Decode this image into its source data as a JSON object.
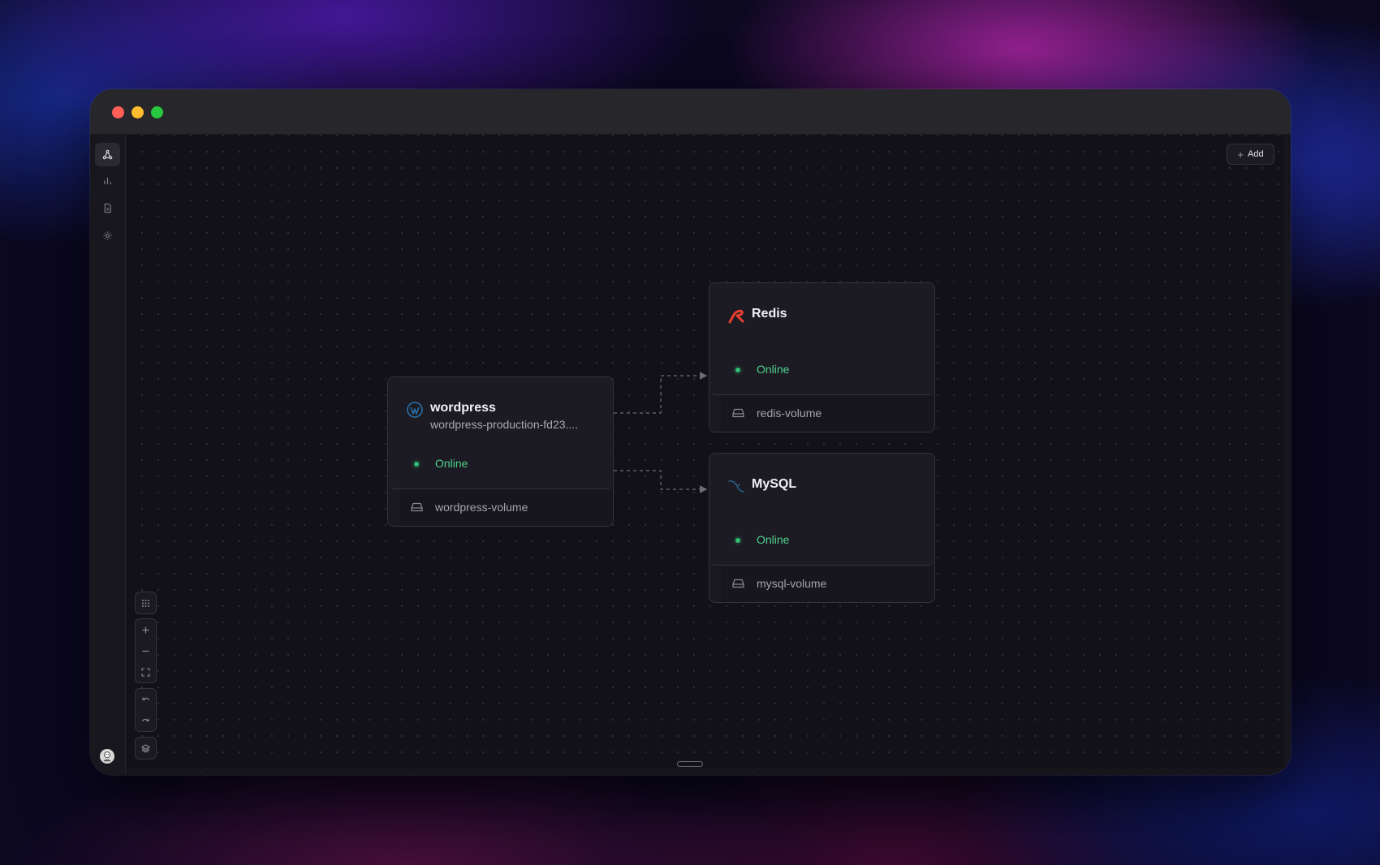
{
  "window": {
    "controls": [
      "close",
      "minimize",
      "maximize"
    ]
  },
  "sidebar": {
    "items": [
      {
        "name": "architecture",
        "icon": "network-icon",
        "active": true
      },
      {
        "name": "metrics",
        "icon": "bar-chart-icon",
        "active": false
      },
      {
        "name": "logs",
        "icon": "document-icon",
        "active": false
      },
      {
        "name": "settings",
        "icon": "gear-icon",
        "active": false
      }
    ],
    "avatar_icon": "user-avatar-icon"
  },
  "toolbar": {
    "add_label": "Add",
    "add_icon": "plus-icon"
  },
  "services": {
    "wordpress": {
      "title": "wordpress",
      "subtitle": "wordpress-production-fd23....",
      "status": "Online",
      "volume": "wordpress-volume",
      "icon": "wordpress-icon"
    },
    "redis": {
      "title": "Redis",
      "status": "Online",
      "volume": "redis-volume",
      "icon": "redis-icon"
    },
    "mysql": {
      "title": "MySQL",
      "status": "Online",
      "volume": "mysql-volume",
      "icon": "mysql-dolphin-icon"
    }
  },
  "canvas_controls": [
    "grid-icon",
    "zoom-in-icon",
    "zoom-out-icon",
    "fit-view-icon",
    "undo-icon",
    "redo-icon",
    "layers-icon"
  ],
  "colors": {
    "online": "#4fd08c",
    "redis": "#e8402f",
    "wordpress": "#2b6fa8",
    "mysql": "#2a5f86"
  }
}
